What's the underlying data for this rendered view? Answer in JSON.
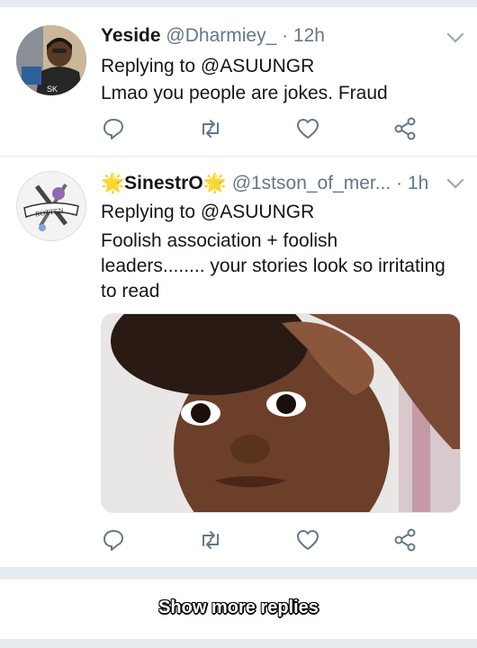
{
  "tweets": [
    {
      "name": "Yeside",
      "handle": "@Dharmiey_",
      "time": "· 12h",
      "replying_prefix": "Replying to",
      "replying_handle": "@ASUUNGR",
      "text": "Lmao you people are jokes. Fraud",
      "actions": [
        "reply-icon",
        "retweet-icon",
        "like-icon",
        "share-icon"
      ]
    },
    {
      "name": "SinestrO",
      "name_emoji": "🌟",
      "handle": "@1stson_of_mer...",
      "time": "· 1h",
      "replying_prefix": "Replying to",
      "replying_handle": "@ASUUNGR",
      "text_lines": [
        "Foolish association + foolish",
        "leaders........ your stories look so irritating",
        "to read"
      ],
      "avatar_label": "ROTTEN",
      "actions": [
        "reply-icon",
        "retweet-icon",
        "like-icon",
        "share-icon"
      ]
    }
  ],
  "show_more": "Show more replies",
  "colors": {
    "icon": "#657786",
    "divider": "#e6ecf0",
    "text": "#14171a",
    "secondary": "#657786"
  }
}
